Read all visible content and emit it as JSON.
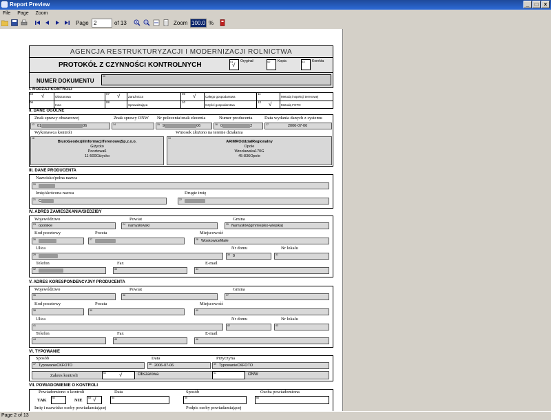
{
  "window": {
    "title": "Report Preview"
  },
  "menu": [
    "File",
    "Page",
    "Zoom"
  ],
  "toolbar": {
    "page_label": "Page",
    "page_value": "2",
    "page_of": "of 13",
    "zoom_label": "Zoom",
    "zoom_value": "100.0",
    "zoom_unit": "%"
  },
  "status": {
    "text": "Page 2 of 13"
  },
  "document": {
    "agency": "AGENCJA RESTRUKTURYZACJI I MODERNIZACJI ROLNICTWA",
    "title": "PROTOKÓŁ Z CZYNNOŚCI KONTROLNYCH",
    "copies": {
      "original": "Oryginał",
      "copy": "Kopia",
      "correction": "Korekta",
      "n1": "01",
      "n2": "02",
      "n3": "03",
      "check1": "√"
    },
    "doc_number_label": "NUMER DOKUMENTU",
    "doc_number_n": "00",
    "s1": {
      "title": "I. RODZAJ KONTROLI",
      "items": [
        {
          "n": "03",
          "label": "Obszarowa",
          "check": "√"
        },
        {
          "n": "07",
          "label": "Zaraźnicza",
          "check": "√"
        },
        {
          "n": "09",
          "label": "Całego gospodarstwa",
          "check": "√"
        },
        {
          "n": "11",
          "label": "Metodą inspekcji terenowej",
          "check": ""
        },
        {
          "n": "06",
          "label": "Inna",
          "check": ""
        },
        {
          "n": "08",
          "label": "Sprawdzająca",
          "check": ""
        },
        {
          "n": "10",
          "label": "Części gospodarstwa",
          "check": ""
        },
        {
          "n": "12",
          "label": "Metodą FOTO",
          "check": "√"
        }
      ]
    },
    "s2": {
      "title": "II. DANE OGÓLNE",
      "h1": "Znak sprawy obszarowej",
      "h2": "Znak sprawy ONW",
      "h3": "Nr polecenia/znak zlecenia",
      "h4": "Numer producenta",
      "h5": "Data wydania danych z systemu",
      "f1n": "13",
      "f1v": "01",
      "f1s": "06",
      "f2n": "14",
      "f3n": "15",
      "f3v": "9",
      "f3s": "06",
      "f4n": "16",
      "f4v": "0",
      "f4s": "2",
      "f5n": "17",
      "f5v": "2006-07-06",
      "wk_label": "Wykonawca kontroli",
      "wn_label": "Wniosek złożono na terenie działania",
      "wk_n": "18",
      "wk_name": "BiuroGeodezjiiInformacjiTerenowejSp.z.o.o.",
      "wk_l2": "Giżycko",
      "wk_l3": "Pocztowa6",
      "wk_l4": "11-500Giżycko",
      "wn_n": "19",
      "wn_name": "ARiMROddziałRegionalny",
      "wn_l2": "Opole",
      "wn_l3": "Wrocławska170G",
      "wn_l4": "45-836Opole"
    },
    "s3": {
      "title": "III. DANE PRODUCENTA",
      "name_label": "Nazwisko/pełna nazwa",
      "name_n": "20",
      "fname_label": "Imię/skrócona nazwa",
      "fname_n": "21",
      "fname_v": "C",
      "sname_label": "Drugie imię",
      "sname_n": "22"
    },
    "s4": {
      "title": "IV. ADRES ZAMIESZKANIA/SIEDZIBY",
      "woj": "Województwo",
      "pow": "Powiat",
      "gmi": "Gmina",
      "woj_n": "23",
      "woj_v": "opolskie",
      "pow_n": "24",
      "pow_v": "namysłowski",
      "gmi_n": "25",
      "gmi_v": "Namysłów(gmmiejsko-wiejska)",
      "kod": "Kod pocztowy",
      "pocz": "Poczta",
      "miej": "Miejscowość",
      "kod_n": "26",
      "pocz_n": "27",
      "miej_n": "28",
      "miej_v": "WoskowiceMałe",
      "ulica": "Ulica",
      "nrd": "Nr domu",
      "nrl": "Nr lokalu",
      "ul_n": "29",
      "nrd_n": "30",
      "nrd_v": "9",
      "nrl_n": "31",
      "tel": "Telefon",
      "fax": "Fax",
      "email": "E-mail",
      "tel_n": "32",
      "fax_n": "33",
      "email_n": "34"
    },
    "s5": {
      "title": "V. ADRES KORESPONDENCYJNY PRODUCENTA",
      "woj": "Województwo",
      "pow": "Powiat",
      "gmi": "Gmina",
      "woj_n": "35",
      "pow_n": "36",
      "gmi_n": "37",
      "kod": "Kod pocztowy",
      "pocz": "Poczta",
      "miej": "Miejscowość",
      "kod_n": "38",
      "pocz_n": "39",
      "miej_n": "40",
      "ulica": "Ulica",
      "nrd": "Nr domu",
      "nrl": "Nr lokalu",
      "ul_n": "41",
      "nrd_n": "42",
      "nrl_n": "43",
      "tel": "Telefon",
      "fax": "Fax",
      "email": "E-mail",
      "tel_n": "44",
      "fax_n": "45",
      "email_n": "46"
    },
    "s6": {
      "title": "VI. TYPOWANIE",
      "sposob": "Sposób",
      "data": "Data",
      "przyczyna": "Przyczyna",
      "sp_n": "47",
      "sp_v": "TypowanieCKFOTO",
      "d_n": "48",
      "d_v": "2006-07-06",
      "pr_n": "49",
      "pr_v": "TypowanieCKFOTO",
      "zakres": "Zakres kontroli",
      "z1_n": "50",
      "z1_c": "√",
      "z1_l": "Obszarowa",
      "z2_n": "51",
      "z2_l": "ONW"
    },
    "s7": {
      "title": "VII. POWIADOMIENIE O KONTROLI",
      "pow_label": "Powiadomiono o kontroli",
      "data": "Data",
      "sposob": "Sposób",
      "osoba": "Osoba powiadomiona",
      "tak": "TAK",
      "nie": "NIE",
      "tak_n": "52",
      "nie_n": "53",
      "nie_c": "√",
      "d_n": "54",
      "sp_n": "55",
      "os_n": "56",
      "footer1": "Imię i nazwisko osoby powiadamiającej",
      "footer2": "Podpis osoby powiadamiającej"
    }
  }
}
